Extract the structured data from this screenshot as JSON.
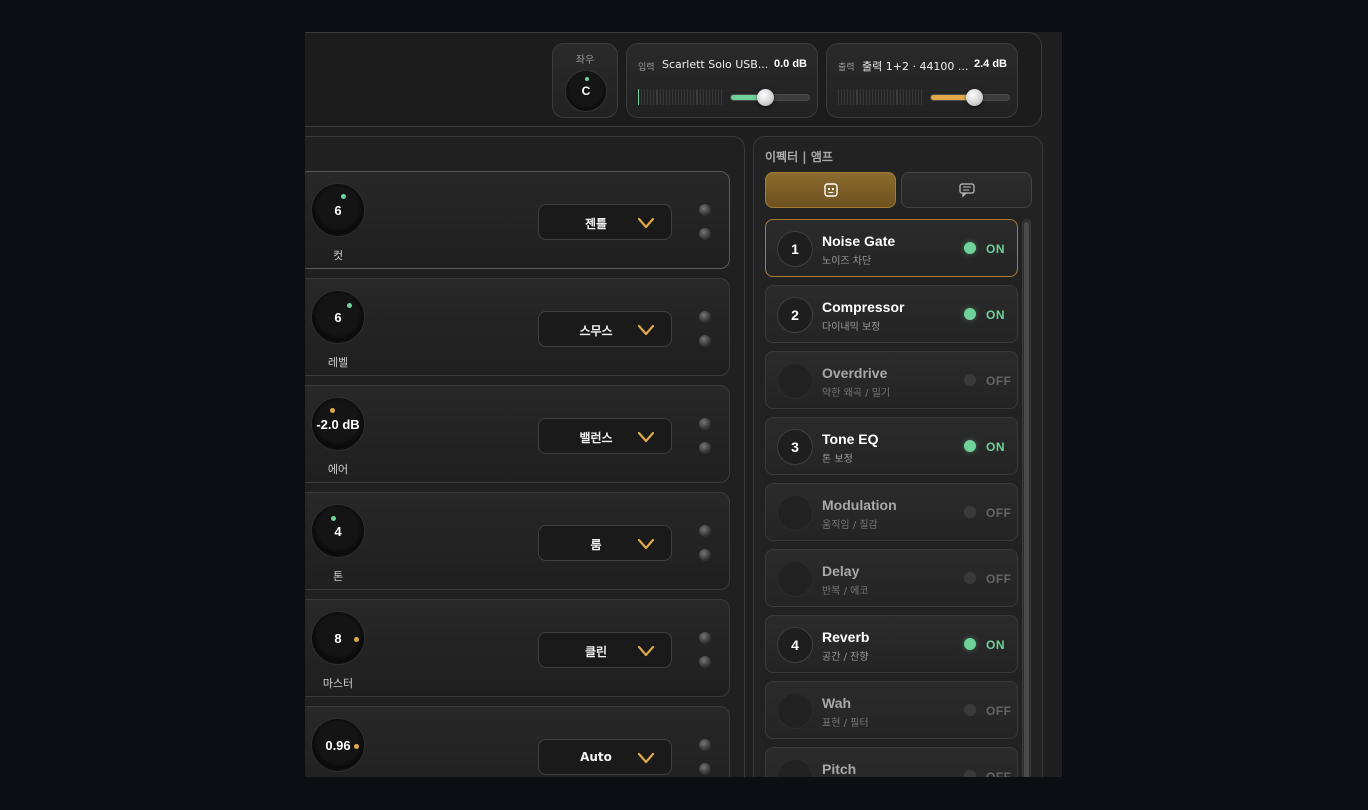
{
  "pan": {
    "label": "좌우",
    "value": "C"
  },
  "input": {
    "tag": "입력",
    "device": "Scarlett Solo USB...",
    "gain_db": "0.0 dB",
    "level": 0.44,
    "accent": "#6fd29a"
  },
  "output": {
    "tag": "출력",
    "device": "출력 1+2 · 44100 ...",
    "gain_db": "2.4 dB",
    "level": 0.55,
    "accent": "#e0a94a"
  },
  "controls": [
    {
      "knob_value": "6",
      "knob_label": "컷",
      "dot_color": "#6fd29a",
      "select": "젠틀"
    },
    {
      "knob_value": "6",
      "knob_label": "레벨",
      "dot_color": "#6fd29a",
      "select": "스무스"
    },
    {
      "knob_value": "-2.0 dB",
      "knob_label": "에어",
      "dot_color": "#e0a94a",
      "select": "밸런스"
    },
    {
      "knob_value": "4",
      "knob_label": "톤",
      "dot_color": "#6fd29a",
      "select": "룸"
    },
    {
      "knob_value": "8",
      "knob_label": "마스터",
      "dot_color": "#e0a94a",
      "select": "클린"
    },
    {
      "knob_value": "0.96",
      "knob_label": "",
      "dot_color": "#e0a94a",
      "select": "Auto"
    }
  ],
  "effects_panel": {
    "title": "이펙터 | 앰프",
    "tabs": [
      {
        "icon": "amp-face-icon"
      },
      {
        "icon": "chat-bubble-icon"
      }
    ],
    "effects": [
      {
        "num": "1",
        "name": "Noise Gate",
        "sub": "노이즈 차단",
        "state": "ON",
        "on": true
      },
      {
        "num": "2",
        "name": "Compressor",
        "sub": "다이내믹 보정",
        "state": "ON",
        "on": true
      },
      {
        "num": "",
        "name": "Overdrive",
        "sub": "약한 왜곡 / 밀기",
        "state": "OFF",
        "on": false
      },
      {
        "num": "3",
        "name": "Tone EQ",
        "sub": "톤 보정",
        "state": "ON",
        "on": true
      },
      {
        "num": "",
        "name": "Modulation",
        "sub": "움직임 / 질감",
        "state": "OFF",
        "on": false
      },
      {
        "num": "",
        "name": "Delay",
        "sub": "반복 / 에코",
        "state": "OFF",
        "on": false
      },
      {
        "num": "4",
        "name": "Reverb",
        "sub": "공간 / 잔향",
        "state": "ON",
        "on": true
      },
      {
        "num": "",
        "name": "Wah",
        "sub": "표현 / 필터",
        "state": "OFF",
        "on": false
      },
      {
        "num": "",
        "name": "Pitch",
        "sub": "",
        "state": "OFF",
        "on": false
      }
    ]
  }
}
